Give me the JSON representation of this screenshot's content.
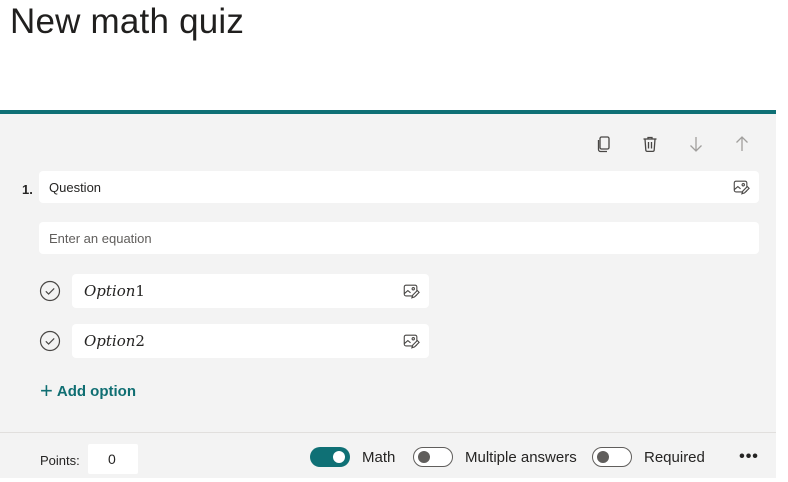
{
  "quiz": {
    "title": "New math quiz"
  },
  "question": {
    "number": "1.",
    "text": "Question",
    "equation_placeholder": "Enter an equation",
    "options": [
      {
        "word": "Option",
        "num": "1"
      },
      {
        "word": "Option",
        "num": "2"
      }
    ],
    "add_option_label": "Add option"
  },
  "footer": {
    "points_label": "Points:",
    "points_value": "0",
    "toggles": [
      {
        "label": "Math",
        "on": true
      },
      {
        "label": "Multiple answers",
        "on": false
      },
      {
        "label": "Required",
        "on": false
      }
    ],
    "more_label": "•••"
  },
  "icons": {
    "copy": "copy-icon",
    "delete": "trash-icon",
    "move_down": "arrow-down-icon",
    "move_up": "arrow-up-icon",
    "insert_image": "image-edit-icon",
    "check": "check-circle-icon",
    "add": "plus-icon",
    "more": "more-horizontal-icon"
  },
  "colors": {
    "accent": "#0f7075",
    "card_bg": "#f3f3f3"
  }
}
